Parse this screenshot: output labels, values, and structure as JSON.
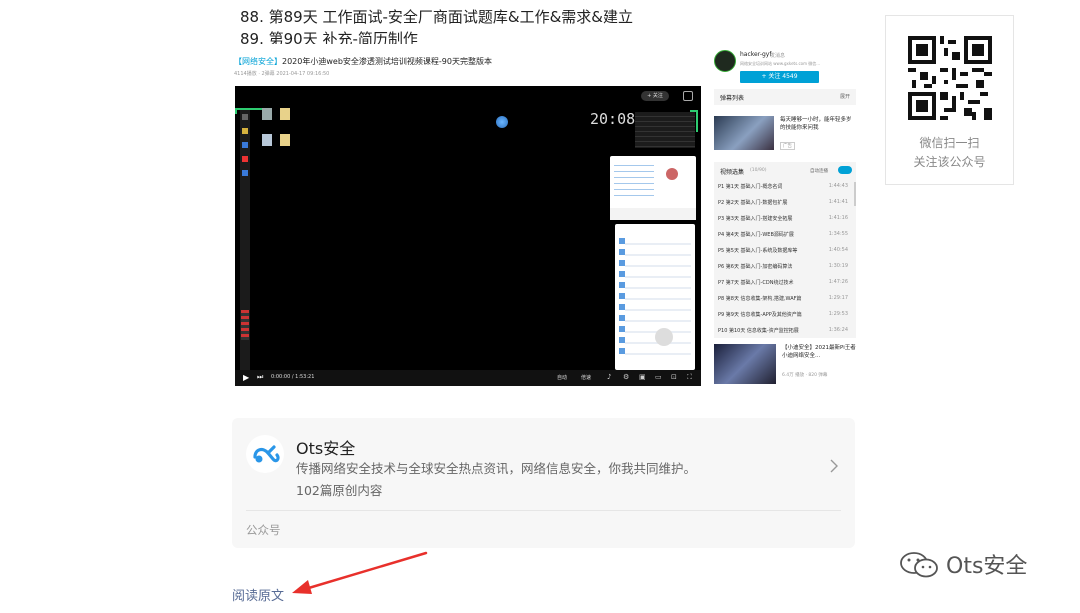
{
  "article": {
    "list_items": [
      "88. 第89天 工作面试-安全厂商面试题库&工作&需求&建立",
      "89. 第90天 补充-简历制作"
    ]
  },
  "video_screenshot": {
    "title_tag": "【网络安全】",
    "title_rest": "2020年小迪web安全渗透测试培训视频课程-90天完整版本",
    "meta": "4114播放 · 2弹幕   2021-04-17 09:16:50",
    "clock": "20:08",
    "player_time": "0:00:00 / 1:53:21",
    "player_quality": "自动",
    "player_speed": "倍速",
    "uploader_name": "hacker-gyf",
    "uploader_tag": "发消息",
    "uploader_desc": "网络安全培训网站 www.gxkets.com 微信...",
    "follow_label": "+ 关注 4549",
    "danmaku_header": "弹幕列表",
    "danmaku_toggle": "展开",
    "ad_title": "每天睡够一小时，能年轻多岁的技能你来问我",
    "ad_tag": "广告",
    "playlist_header": "视频选集",
    "playlist_count": "(10/90)",
    "autoplay_label": "自动连播",
    "playlist": [
      {
        "label": "P1  第1天 基础入门-概念名词",
        "dur": "1:44:43"
      },
      {
        "label": "P2  第2天 基础入门-数据包扩展",
        "dur": "1:41:41"
      },
      {
        "label": "P3  第3天 基础入门-搭建安全拓展",
        "dur": "1:41:16"
      },
      {
        "label": "P4  第4天 基础入门-WEB源码扩展",
        "dur": "1:34:55"
      },
      {
        "label": "P5  第5天 基础入门-系统及数据库等",
        "dur": "1:40:54"
      },
      {
        "label": "P6  第6天 基础入门-加密编码算法",
        "dur": "1:30:19"
      },
      {
        "label": "P7  第7天 基础入门-CDN绕过技术",
        "dur": "1:47:26"
      },
      {
        "label": "P8  第8天 信息收集-架构,搭建,WAF篇",
        "dur": "1:29:17"
      },
      {
        "label": "P9  第9天 信息收集-APP及其他资产篇",
        "dur": "1:29:53"
      },
      {
        "label": "P10 第10天 信息收集-资产监控拓展",
        "dur": "1:36:24"
      }
    ],
    "rec_title": "【小迪安全】2021最新Pi王者小迪网络安全...",
    "rec_meta": "6.4万 播放 · 820 弹幕"
  },
  "qr": {
    "caption_line1": "微信扫一扫",
    "caption_line2": "关注该公众号"
  },
  "profile_card": {
    "name": "Ots安全",
    "description": "传播网络安全技术与全球安全热点资讯，网络信息安全，你我共同维护。",
    "article_count": "102篇原创内容",
    "footer_label": "公众号"
  },
  "read_more": "阅读原文",
  "watermark": "Ots安全",
  "colors": {
    "link": "#576b95",
    "bilibili_blue": "#00a1d6",
    "annotation_arrow": "#e8302b",
    "logo_blue": "#2a96e8"
  }
}
